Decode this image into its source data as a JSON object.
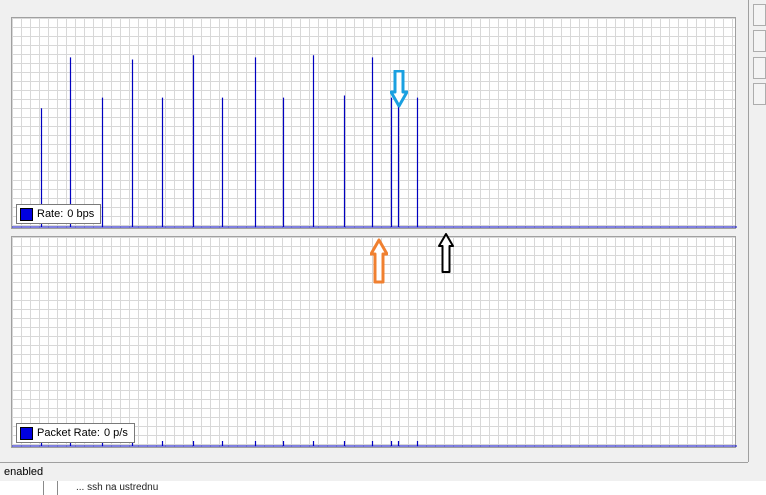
{
  "rate_graph": {
    "legend_label": "Rate:",
    "legend_value": "0 bps",
    "series_color": "#0000c0",
    "legend_color": "#0000e0",
    "spikes": [
      {
        "pos": 0.04,
        "level": 0.56
      },
      {
        "pos": 0.08,
        "level": 0.8
      },
      {
        "pos": 0.124,
        "level": 0.61
      },
      {
        "pos": 0.165,
        "level": 0.79
      },
      {
        "pos": 0.207,
        "level": 0.61
      },
      {
        "pos": 0.249,
        "level": 0.81
      },
      {
        "pos": 0.29,
        "level": 0.61
      },
      {
        "pos": 0.335,
        "level": 0.8
      },
      {
        "pos": 0.374,
        "level": 0.61
      },
      {
        "pos": 0.415,
        "level": 0.81
      },
      {
        "pos": 0.458,
        "level": 0.62
      },
      {
        "pos": 0.496,
        "level": 0.8
      },
      {
        "pos": 0.523,
        "level": 0.61
      },
      {
        "pos": 0.532,
        "level": 0.62
      },
      {
        "pos": 0.559,
        "level": 0.61
      }
    ]
  },
  "packet_graph": {
    "legend_label": "Packet Rate:",
    "legend_value": "0 p/s",
    "series_color": "#0000c0",
    "legend_color": "#0000e0"
  },
  "status_bar": {
    "text": "enabled"
  },
  "background_item": {
    "text": "... ssh na ustrednu"
  },
  "annotations": [
    {
      "name": "blue-down-arrow",
      "color": "#1aa0e0",
      "direction": "down"
    },
    {
      "name": "orange-up-arrow",
      "color": "#f08030",
      "direction": "up"
    },
    {
      "name": "black-up-arrow",
      "color": "#000000",
      "direction": "up"
    }
  ]
}
